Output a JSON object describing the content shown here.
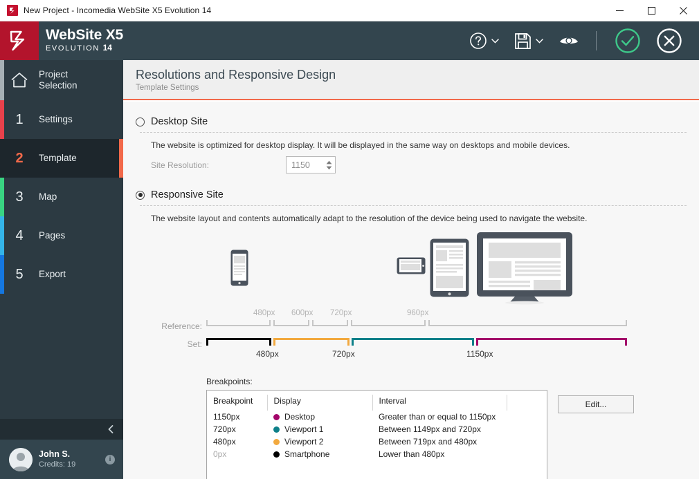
{
  "window": {
    "title": "New Project - Incomedia WebSite X5 Evolution 14",
    "app_icon": "x5-logo-icon",
    "minimize_label": "Minimize",
    "maximize_label": "Maximize",
    "close_label": "Close"
  },
  "header": {
    "brand_name": "WebSite X5",
    "brand_edition": "EVOLUTION",
    "brand_version": "14",
    "tools": [
      {
        "name": "help-icon",
        "label": "Help"
      },
      {
        "name": "save-icon",
        "label": "Save"
      },
      {
        "name": "preview-icon",
        "label": "Preview"
      },
      {
        "name": "confirm-icon",
        "label": "OK"
      },
      {
        "name": "cancel-icon",
        "label": "Cancel"
      }
    ]
  },
  "sidebar": {
    "items": [
      {
        "num": "",
        "label": "Project Selection",
        "label_line1": "Project",
        "label_line2": "Selection",
        "strip": "#a6b0b5",
        "active": false
      },
      {
        "num": "1",
        "label": "Settings",
        "strip": "#e8414b",
        "active": false
      },
      {
        "num": "2",
        "label": "Template",
        "strip": "#f2694a",
        "active": true
      },
      {
        "num": "3",
        "label": "Map",
        "strip": "#39d482",
        "active": false
      },
      {
        "num": "4",
        "label": "Pages",
        "strip": "#34b4e8",
        "active": false
      },
      {
        "num": "5",
        "label": "Export",
        "strip": "#1577e0",
        "active": false
      }
    ],
    "collapse_label": "Collapse sidebar",
    "user": {
      "name": "John S.",
      "credits": "Credits: 19",
      "info_label": "i"
    }
  },
  "page": {
    "title": "Resolutions and Responsive Design",
    "subtitle": "Template Settings"
  },
  "desktop_option": {
    "label": "Desktop Site",
    "selected": false,
    "description": "The website is optimized for desktop display. It will be displayed in the same way on desktops and mobile devices.",
    "resolution_label": "Site Resolution:",
    "resolution_value": "1150",
    "resolution_placeholder": "1150"
  },
  "responsive_option": {
    "label": "Responsive Site",
    "selected": true,
    "description": "The website layout and contents automatically adapt to the resolution of the device being used to navigate the website."
  },
  "ruler": {
    "reference_label": "Reference:",
    "set_label": "Set:",
    "reference_ticks": [
      "480px",
      "600px",
      "720px",
      "960px"
    ],
    "set_ticks": [
      "480px",
      "720px",
      "1150px"
    ],
    "set_segments": [
      {
        "name": "Smartphone",
        "color": "#000000"
      },
      {
        "name": "Viewport 2",
        "color": "#f2a93f"
      },
      {
        "name": "Viewport 1",
        "color": "#0e8089"
      },
      {
        "name": "Desktop",
        "color": "#a3066a"
      }
    ]
  },
  "breakpoints": {
    "title": "Breakpoints:",
    "columns": [
      "Breakpoint",
      "Display",
      "Interval"
    ],
    "rows": [
      {
        "breakpoint": "1150px",
        "display": "Desktop",
        "color": "#a3066a",
        "interval": "Greater than or equal to 1150px",
        "dim": false
      },
      {
        "breakpoint": "720px",
        "display": "Viewport 1",
        "color": "#0e8089",
        "interval": "Between 1149px and 720px",
        "dim": false
      },
      {
        "breakpoint": "480px",
        "display": "Viewport 2",
        "color": "#f2a93f",
        "interval": "Between 719px and 480px",
        "dim": false
      },
      {
        "breakpoint": "0px",
        "display": "Smartphone",
        "color": "#000000",
        "interval": "Lower than 480px",
        "dim": true
      }
    ],
    "edit_label": "Edit..."
  },
  "devices": [
    {
      "name": "smartphone-portrait-icon"
    },
    {
      "name": "smartphone-landscape-icon"
    },
    {
      "name": "tablet-portrait-icon"
    },
    {
      "name": "tablet-landscape-icon"
    },
    {
      "name": "desktop-monitor-icon"
    }
  ],
  "colors": {
    "accent": "#f2694a",
    "header_bg": "#33454e",
    "sidebar_bg": "#2c3a42",
    "brand_red": "#b3142c",
    "confirm_green": "#3ec98a"
  }
}
